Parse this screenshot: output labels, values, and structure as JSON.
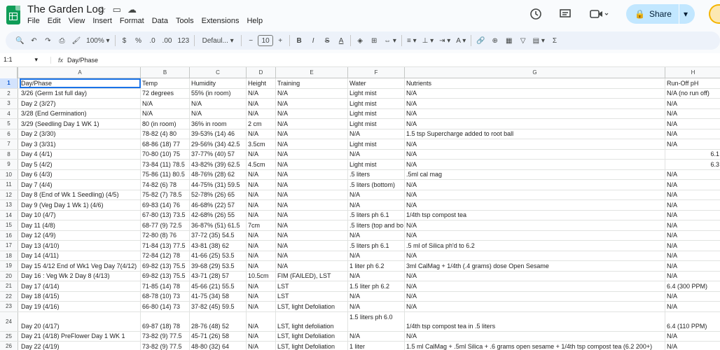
{
  "app": {
    "title": "The Garden Log",
    "menu": [
      "File",
      "Edit",
      "View",
      "Insert",
      "Format",
      "Data",
      "Tools",
      "Extensions",
      "Help"
    ],
    "share_label": "Share"
  },
  "toolbar": {
    "zoom": "100%",
    "currency": "$",
    "percent": "%",
    "dec_decrease": ".0",
    "dec_increase": ".00",
    "number_format": "123",
    "font": "Defaul...",
    "font_size": "10"
  },
  "formula_bar": {
    "cell_ref": "1:1",
    "value": "Day/Phase"
  },
  "columns": [
    "A",
    "B",
    "C",
    "D",
    "E",
    "F",
    "G",
    "H"
  ],
  "rows": [
    {
      "n": "1",
      "cells": [
        "Day/Phase",
        "Temp",
        "Humidity",
        "Height",
        "Training",
        "Water",
        "Nutrients",
        "Run-Off pH"
      ]
    },
    {
      "n": "2",
      "cells": [
        "3/26 (Germ 1st full day)",
        "72 degrees",
        "55% (in room)",
        "N/A",
        "N/A",
        "Light mist",
        "N/A",
        "N/A (no run off)"
      ]
    },
    {
      "n": "3",
      "cells": [
        "Day 2 (3/27)",
        "N/A",
        "N/A",
        "N/A",
        "N/A",
        "Light mist",
        "N/A",
        "N/A"
      ]
    },
    {
      "n": "4",
      "cells": [
        "3/28 (End Germination)",
        "N/A",
        "N/A",
        "N/A",
        "N/A",
        "Light mist",
        "N/A",
        "N/A"
      ]
    },
    {
      "n": "5",
      "cells": [
        "3/29 (Seedling Day 1 WK 1)",
        "80 (in room)",
        "36% in room",
        "2 cm",
        "N/A",
        "Light mist",
        "N/A",
        "N/A"
      ]
    },
    {
      "n": "6",
      "cells": [
        "Day 2 (3/30)",
        "78-82 (4) 80",
        "39-53% (14) 46",
        "N/A",
        "N/A",
        "N/A",
        "1.5 tsp Supercharge added to root ball",
        "N/A"
      ]
    },
    {
      "n": "7",
      "cells": [
        "Day 3 (3/31)",
        "68-86 (18) 77",
        "29-56% (34) 42.5",
        "3.5cm",
        "N/A",
        "Light mist",
        "N/A",
        "N/A"
      ]
    },
    {
      "n": "8",
      "cells": [
        "Day 4 (4/1)",
        "70-80 (10) 75",
        "37-77% (40) 57",
        "N/A",
        "N/A",
        "N/A",
        "N/A",
        "6.1"
      ]
    },
    {
      "n": "9",
      "cells": [
        "Day 5 (4/2)",
        "73-84 (11) 78.5",
        "43-82% (39) 62.5",
        "4.5cm",
        "N/A",
        "Light mist",
        "N/A",
        "6.3"
      ]
    },
    {
      "n": "10",
      "cells": [
        "Day 6 (4/3)",
        "75-86 (11) 80.5",
        "48-76% (28) 62",
        "N/A",
        "N/A",
        ".5 liters",
        ".5ml cal mag",
        "N/A"
      ]
    },
    {
      "n": "11",
      "cells": [
        "Day 7 (4/4)",
        "74-82 (6) 78",
        "44-75% (31) 59.5",
        "N/A",
        "N/A",
        ".5 liters (bottom)",
        "N/A",
        "N/A"
      ]
    },
    {
      "n": "12",
      "cells": [
        "Day 8 (End of Wk 1 Seedling) (4/5)",
        "75-82 (7) 78.5",
        "52-78% (26) 65",
        "N/A",
        "N/A",
        "N/A",
        "N/A",
        "N/A"
      ]
    },
    {
      "n": "13",
      "cells": [
        "Day 9 (Veg Day 1 Wk 1) (4/6)",
        "69-83 (14) 76",
        "46-68% (22) 57",
        "N/A",
        "N/A",
        "N/A",
        "N/A",
        "N/A"
      ]
    },
    {
      "n": "14",
      "cells": [
        "Day 10 (4/7)",
        "67-80 (13) 73.5",
        "42-68% (26) 55",
        "N/A",
        "N/A",
        ".5 liters ph 6.1",
        "1/4th tsp compost tea",
        "N/A"
      ]
    },
    {
      "n": "15",
      "cells": [
        "Day 11 (4/8)",
        "68-77 (9) 72.5",
        "36-87% (51) 61.5",
        "7cm",
        "N/A",
        ".5 liters (top and bo",
        "N/A",
        "N/A"
      ]
    },
    {
      "n": "16",
      "cells": [
        "Day 12 (4/9)",
        "72-80 (8) 76",
        "37-72 (35) 54.5",
        "N/A",
        "N/A",
        "N/A",
        "N/A",
        "N/A"
      ]
    },
    {
      "n": "17",
      "cells": [
        "Day 13 (4/10)",
        "71-84 (13) 77.5",
        "43-81 (38) 62",
        "N/A",
        "N/A",
        ".5 liters ph 6.1",
        ".5 ml of Silica ph'd to 6.2",
        "N/A"
      ]
    },
    {
      "n": "18",
      "cells": [
        "Day 14 (4/11)",
        "72-84 (12) 78",
        "41-66 (25) 53.5",
        "N/A",
        "N/A",
        "N/A",
        "N/A",
        "N/A"
      ]
    },
    {
      "n": "19",
      "cells": [
        "Day 15 4/12 End of Wk1 Veg Day 7(4/12)",
        "69-82 (13) 75.5",
        "39-68 (29) 53.5",
        "N/A",
        "N/A",
        "1 liter ph 6.2",
        "3ml CalMag + 1/4th (.4 grams) dose Open Sesame",
        "N/A"
      ]
    },
    {
      "n": "20",
      "cells": [
        "Day 16 : Veg Wk 2 Day 8  (4/13)",
        "69-82 (13) 75.5",
        "43-71 (28) 57",
        "10.5cm",
        "FIM (FAILED), LST",
        "N/A",
        "N/A",
        "N/A"
      ]
    },
    {
      "n": "21",
      "cells": [
        "Day 17 (4/14)",
        "71-85 (14) 78",
        "45-66 (21) 55.5",
        "N/A",
        "LST",
        "1.5 liter ph 6.2",
        "N/A",
        "6.4 (300 PPM)"
      ]
    },
    {
      "n": "22",
      "cells": [
        "Day 18 (4/15)",
        "68-78 (10) 73",
        "41-75 (34) 58",
        "N/A",
        "LST",
        "N/A",
        "N/A",
        "N/A"
      ]
    },
    {
      "n": "23",
      "cells": [
        "Day 19 (4/16)",
        "66-80 (14) 73",
        "37-82 (45) 59.5",
        "N/A",
        "LST, light Defoliation",
        "N/A",
        "N/A",
        "N/A"
      ]
    },
    {
      "n": "24",
      "cells": [
        "Day 20 (4/17)",
        "69-87 (18) 78",
        "28-76 (48) 52",
        "N/A",
        "LST, light defoliation",
        "1.5 liters ph 6.0",
        "1/4th tsp compost tea in .5 liters",
        "6.4 (110 PPM)"
      ]
    },
    {
      "n": "25",
      "cells": [
        "Day 21 (4/18) PreFlower Day 1 WK 1",
        "73-82 (9) 77.5",
        "45-71 (26) 58",
        "N/A",
        "LST, light Defoliation",
        "N/A",
        "N/A",
        "N/A"
      ]
    },
    {
      "n": "26",
      "cells": [
        "Day 22 (4/19)",
        "73-82 (9) 77.5",
        "48-80 (32) 64",
        "N/A",
        "LST, light Defoliation",
        "1 liter",
        "1.5 ml CalMag + .5ml Silica + .6 grams open sesame + 1/4th tsp compost tea (6.2 200+)",
        "N/A"
      ]
    }
  ]
}
